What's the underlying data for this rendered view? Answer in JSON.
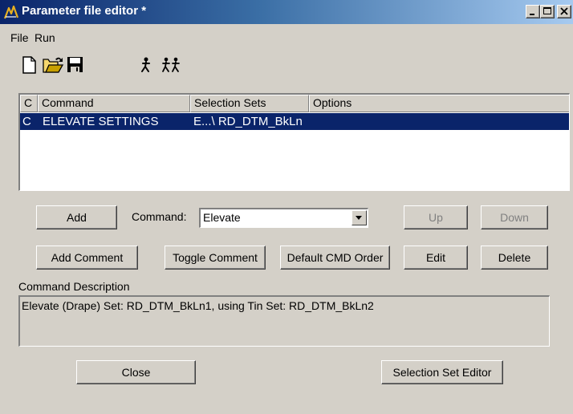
{
  "window": {
    "title": "Parameter file editor *"
  },
  "menu": {
    "file": "File",
    "run": "Run"
  },
  "toolbar": {
    "icons": [
      "new-file-icon",
      "open-folder-icon",
      "save-icon",
      "run-one-icon",
      "run-all-icon"
    ]
  },
  "list": {
    "columns": [
      "C",
      "Command",
      "Selection Sets",
      "Options"
    ],
    "rows": [
      {
        "c": "C",
        "command": "ELEVATE SETTINGS",
        "selection_sets": "E...\\ RD_DTM_BkLn",
        "options": "",
        "selected": true
      }
    ]
  },
  "controls": {
    "add": "Add",
    "command_label": "Command:",
    "command_value": "Elevate",
    "up": "Up",
    "down": "Down",
    "add_comment": "Add Comment",
    "toggle_comment": "Toggle Comment",
    "default_cmd_order": "Default CMD Order",
    "edit": "Edit",
    "delete": "Delete"
  },
  "description": {
    "label": "Command Description",
    "text": "Elevate (Drape) Set: RD_DTM_BkLn1, using Tin Set: RD_DTM_BkLn2"
  },
  "footer": {
    "close": "Close",
    "selection_set_editor": "Selection Set Editor"
  },
  "colors": {
    "window_bg": "#d4d0c8",
    "title_start": "#0a246a",
    "title_end": "#a6caf0",
    "selection": "#0a246a",
    "disabled_text": "#808080"
  }
}
